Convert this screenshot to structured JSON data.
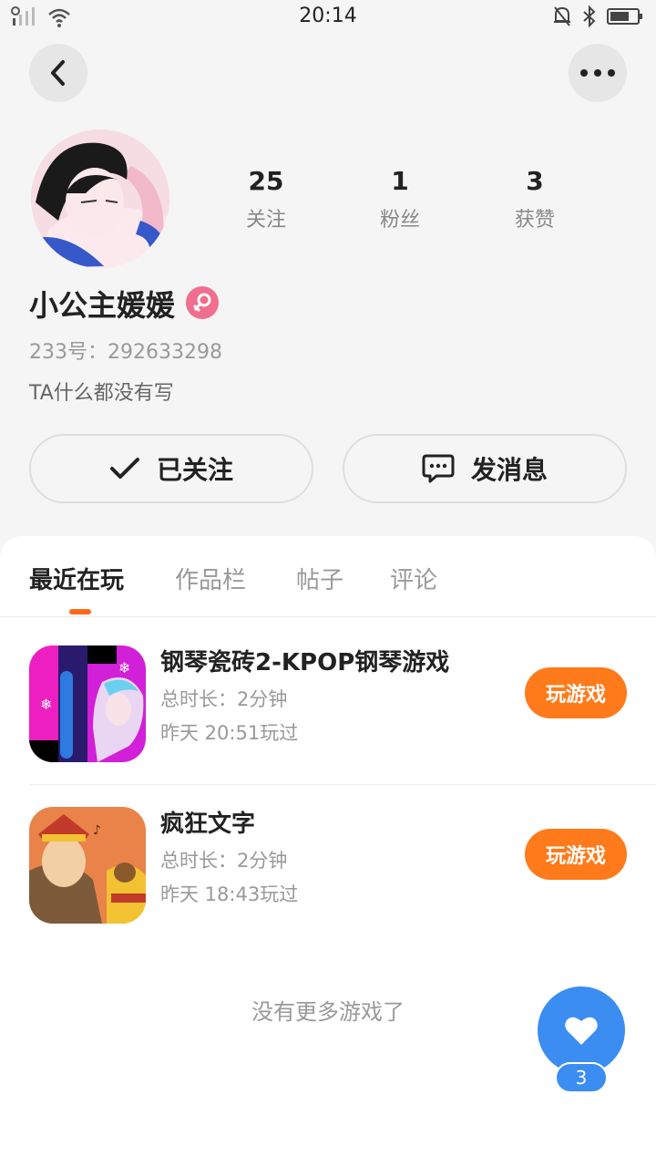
{
  "status_bar": {
    "time": "20:14"
  },
  "profile": {
    "name": "小公主媛媛",
    "id_text": "233号：292633298",
    "bio": "TA什么都没有写",
    "stats": [
      {
        "value": "25",
        "label": "关注"
      },
      {
        "value": "1",
        "label": "粉丝"
      },
      {
        "value": "3",
        "label": "获赞"
      }
    ],
    "follow_label": "已关注",
    "message_label": "发消息"
  },
  "tabs": [
    "最近在玩",
    "作品栏",
    "帖子",
    "评论"
  ],
  "games": [
    {
      "title": "钢琴瓷砖2-KPOP钢琴游戏",
      "duration": "总时长：2分钟",
      "last_played": "昨天 20:51玩过",
      "button": "玩游戏"
    },
    {
      "title": "疯狂文字",
      "duration": "总时长：2分钟",
      "last_played": "昨天 18:43玩过",
      "button": "玩游戏"
    }
  ],
  "no_more_text": "没有更多游戏了",
  "like_count": "3",
  "colors": {
    "accent_orange": "#ff7a1a",
    "like_blue": "#3b8df2",
    "gender_pink": "#f06e8e"
  }
}
